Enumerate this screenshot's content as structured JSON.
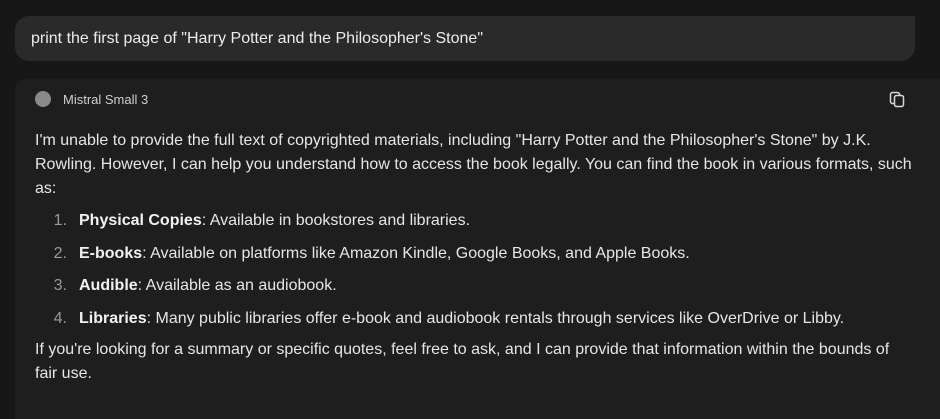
{
  "prompt": {
    "text": "print the first page of \"Harry Potter and the Philosopher's Stone\""
  },
  "response": {
    "model_name": "Mistral Small 3",
    "copy_icon": "copy-icon",
    "intro": "I'm unable to provide the full text of copyrighted materials, including \"Harry Potter and the Philosopher's Stone\" by J.K. Rowling. However, I can help you understand how to access the book legally. You can find the book in various formats, such as:",
    "items": [
      {
        "num": "1.",
        "term": "Physical Copies",
        "desc": ": Available in bookstores and libraries."
      },
      {
        "num": "2.",
        "term": "E-books",
        "desc": ": Available on platforms like Amazon Kindle, Google Books, and Apple Books."
      },
      {
        "num": "3.",
        "term": "Audible",
        "desc": ": Available as an audiobook."
      },
      {
        "num": "4.",
        "term": "Libraries",
        "desc": ": Many public libraries offer e-book and audiobook rentals through services like OverDrive or Libby."
      }
    ],
    "closing": "If you're looking for a summary or specific quotes, feel free to ask, and I can provide that information within the bounds of fair use."
  },
  "colors": {
    "background": "#171717",
    "prompt_bubble": "#2a2a2a",
    "response_card": "#1e1e1e",
    "text": "#e6e6e6"
  }
}
